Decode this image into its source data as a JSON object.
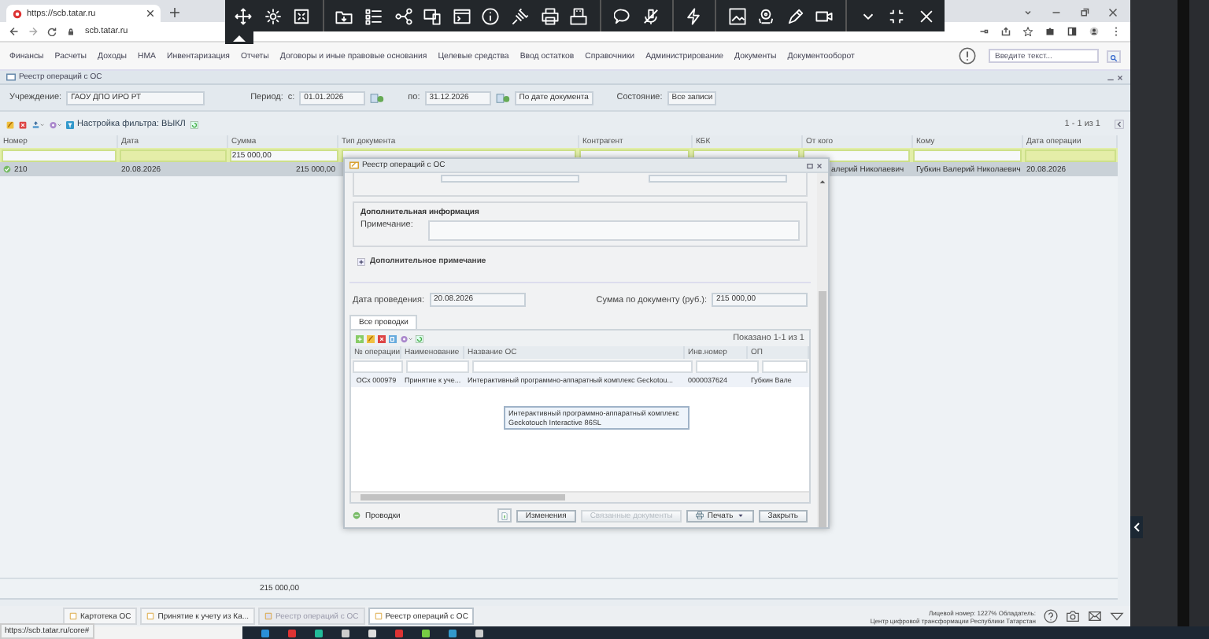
{
  "browser": {
    "tab_title": "https://scb.tatar.ru",
    "url": "scb.tatar.ru"
  },
  "menu": [
    "Финансы",
    "Расчеты",
    "Доходы",
    "НМА",
    "Инвентаризация",
    "Отчеты",
    "Договоры и иные правовые основания",
    "Целевые средства",
    "Ввод остатков",
    "Справочники",
    "Администрирование",
    "Документы",
    "Документооборот"
  ],
  "search": {
    "placeholder": "Введите текст..."
  },
  "panel": {
    "title": "Реестр операций с ОС"
  },
  "filters": {
    "institution_label": "Учреждение:",
    "institution": "ГАОУ ДПО ИРО РТ",
    "period_label": "Период:",
    "from_label": "с:",
    "from": "01.01.2026",
    "to_label": "по:",
    "to": "31.12.2026",
    "date_mode": "По дате документа",
    "state_label": "Состояние:",
    "state": "Все записи"
  },
  "toolbar": {
    "filter_setting": "Настройка фильтра: ВЫКЛ",
    "count": "1 - 1 из 1"
  },
  "table": {
    "columns": [
      "Номер",
      "Дата",
      "Сумма",
      "Тип документа",
      "Контрагент",
      "КБК",
      "От кого",
      "Кому",
      "Дата операции"
    ],
    "sum_filter": "215 000,00",
    "rows": [
      {
        "number": "210",
        "date": "20.08.2026",
        "sum": "215 000,00",
        "from": "алерий Николаевич",
        "to": "Губкин Валерий Николаевич",
        "op_date": "20.08.2026",
        "selected": true
      }
    ],
    "total": "215 000,00"
  },
  "dialog": {
    "title": "Реестр операций с ОС",
    "info_legend": "Дополнительная информация",
    "note_label": "Примечание:",
    "extra_note": "Дополнительное примечание",
    "extra_expanded": false,
    "date_label": "Дата проведения:",
    "date": "20.08.2026",
    "sum_label": "Сумма по документу (руб.):",
    "sum": "215 000,00",
    "tabs": [
      {
        "label": "Все проводки",
        "selected": true
      }
    ],
    "grid_count": "Показано 1-1 из 1",
    "grid_columns": [
      "№ операции",
      "Наименование",
      "Название ОС",
      "Инв.номер",
      "ОП"
    ],
    "grid_rows": [
      [
        "ОСх 000979",
        "Принятие к уче...",
        "Интерактивный программно-аппаратный комплекс Geckotou...",
        "0000037624",
        "Губкин Вале"
      ]
    ],
    "tooltip": "Интерактивный программно-аппаратный комплекс Geckotouch Interactive 86SL",
    "footer_label": "Проводки",
    "buttons": [
      {
        "label": "Изменения",
        "disabled": false,
        "dropdown": false
      },
      {
        "label": "Связанные документы",
        "disabled": true,
        "dropdown": false
      },
      {
        "label": "Печать",
        "disabled": false,
        "dropdown": true
      },
      {
        "label": "Закрыть",
        "disabled": false,
        "dropdown": false
      }
    ]
  },
  "bottom_tabs": [
    {
      "label": "Картотека ОС",
      "selected": false,
      "disabled": false
    },
    {
      "label": "Принятие к учету из Ка...",
      "selected": false,
      "disabled": false
    },
    {
      "label": "Реестр операций с ОС",
      "selected": false,
      "disabled": true
    },
    {
      "label": "Реестр операций с ОС",
      "selected": true,
      "disabled": false
    }
  ],
  "status_url": "https://scb.tatar.ru/core#",
  "license": {
    "line1": "Лицевой номер: 1227% Обладатель:",
    "line2": "Центр цифровой трансформации Республики Татарстан"
  }
}
